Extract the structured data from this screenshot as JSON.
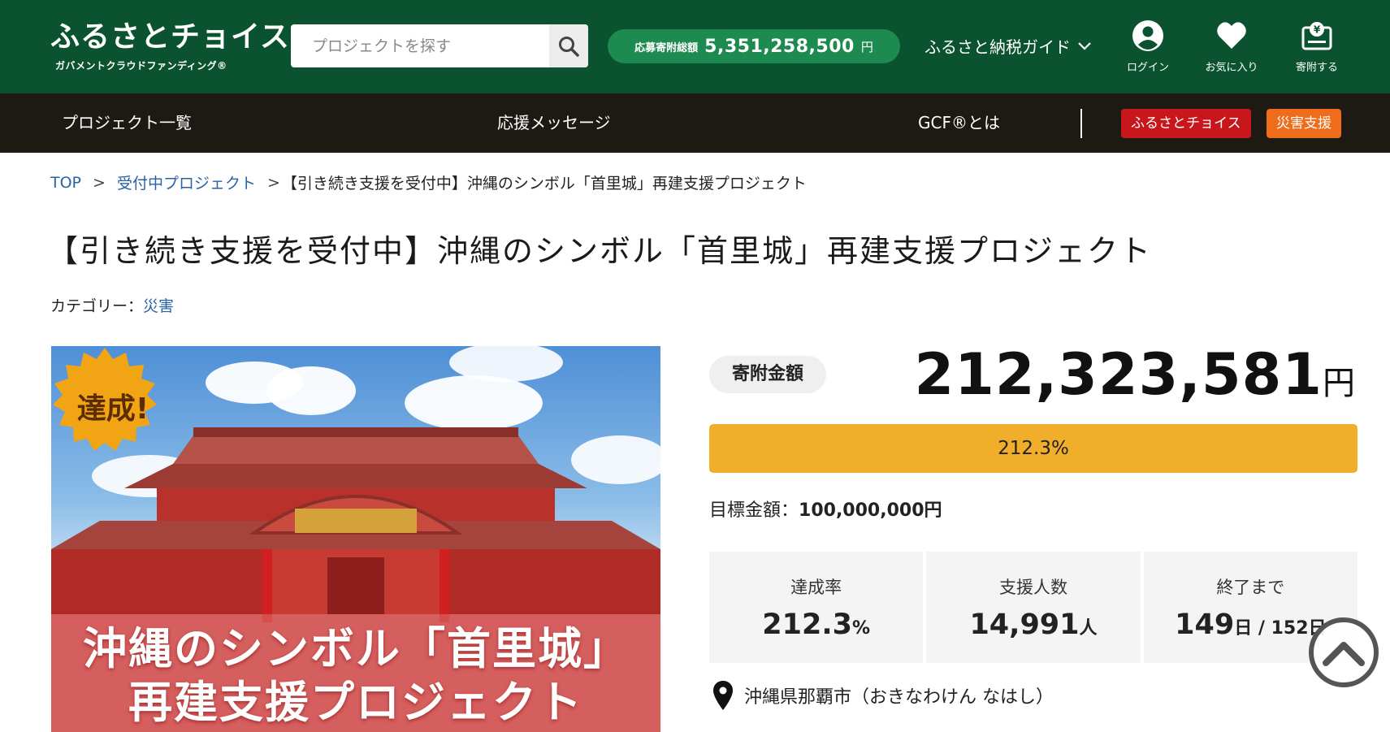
{
  "header": {
    "logo_main": "ふるさとチョイス",
    "logo_sub": "ガバメントクラウドファンディング®",
    "search_placeholder": "プロジェクトを探す",
    "total_label": "応募寄附総額",
    "total_value": "5,351,258,500",
    "total_unit": "円",
    "guide_label": "ふるさと納税ガイド",
    "login_label": "ログイン",
    "favorites_label": "お気に入り",
    "donate_label": "寄附する",
    "colors": {
      "header_bg": "#0b5330",
      "pill_bg": "#1d8a4f"
    }
  },
  "nav": {
    "items": [
      "プロジェクト一覧",
      "応援メッセージ",
      "GCF®とは"
    ],
    "badge_choice": "ふるさとチョイス",
    "badge_disaster": "災害支援",
    "colors": {
      "nav_bg": "#1d1a14",
      "badge_choice": "#c8161d",
      "badge_disaster": "#ef6c1a"
    }
  },
  "breadcrumb": {
    "top": "TOP",
    "sep": ">",
    "projects": "受付中プロジェクト",
    "current": "【引き続き支援を受付中】沖縄のシンボル「首里城」再建支援プロジェクト"
  },
  "project": {
    "title": "【引き続き支援を受付中】沖縄のシンボル「首里城」再建支援プロジェクト",
    "category_label": "カテゴリー：",
    "category_value": "災害",
    "hero_badge": "達成!",
    "hero_line1": "沖縄のシンボル「首里城」",
    "hero_line2": "再建支援プロジェクト",
    "amount_label": "寄附金額",
    "amount_value": "212,323,581",
    "amount_unit": "円",
    "progress_text": "212.3%",
    "progress_fraction": 1.0,
    "goal_label": "目標金額：",
    "goal_value": "100,000,000円",
    "stats": {
      "rate_label": "達成率",
      "rate_value": "212.3",
      "rate_unit": "%",
      "supporters_label": "支援人数",
      "supporters_value": "14,991",
      "supporters_unit": "人",
      "remaining_label": "終了まで",
      "remaining_value": "149",
      "remaining_unit": "日",
      "remaining_total": " / 152日"
    },
    "location": "沖縄県那覇市（おきなわけん なはし）",
    "colors": {
      "progress": "#f1ae2b",
      "link": "#2863a6"
    }
  }
}
